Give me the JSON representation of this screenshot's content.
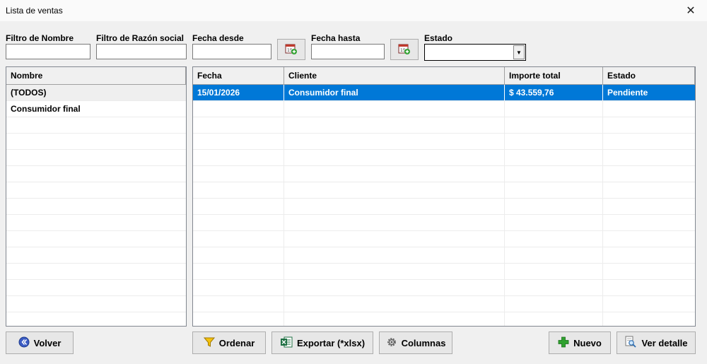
{
  "window": {
    "title": "Lista de ventas",
    "close_glyph": "✕"
  },
  "filters": {
    "nombre_label": "Filtro de Nombre",
    "razon_label": "Filtro de Razón social",
    "desde_label": "Fecha desde",
    "hasta_label": "Fecha hasta",
    "estado_label": "Estado",
    "nombre_value": "",
    "razon_value": "",
    "desde_value": "",
    "hasta_value": "",
    "estado_value": ""
  },
  "left_grid": {
    "header": "Nombre",
    "rows": [
      "(TODOS)",
      "Consumidor final"
    ]
  },
  "main_grid": {
    "columns": [
      "Fecha",
      "Cliente",
      "Importe total",
      "Estado"
    ],
    "rows": [
      {
        "fecha": "15/01/2026",
        "cliente": "Consumidor final",
        "importe": "$ 43.559,76",
        "estado": "Pendiente"
      }
    ]
  },
  "buttons": {
    "volver": "Volver",
    "ordenar": "Ordenar",
    "exportar": "Exportar (*xlsx)",
    "columnas": "Columnas",
    "nuevo": "Nuevo",
    "ver_detalle": "Ver detalle"
  },
  "icons": {
    "calendar": "calendar-icon",
    "back": "back-icon",
    "filter": "funnel-icon",
    "excel": "excel-icon",
    "gear": "gear-icon",
    "plus": "plus-icon",
    "search": "magnifier-icon"
  },
  "colors": {
    "selection": "#0078d7",
    "plus_green": "#2fa12f"
  }
}
